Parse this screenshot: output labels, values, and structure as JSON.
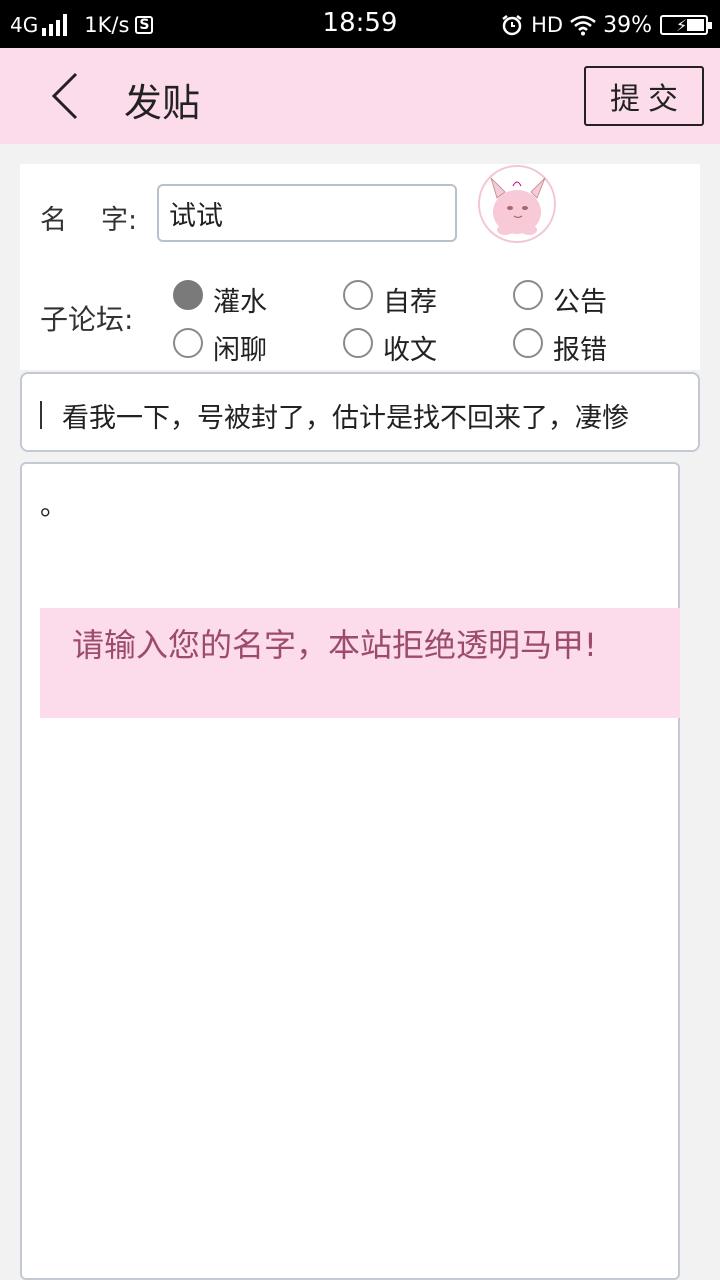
{
  "status_bar": {
    "network": "4G",
    "speed": "1K/s",
    "time": "18:59",
    "hd": "HD",
    "battery_percent": "39%",
    "battery_level": 0.39,
    "icons": [
      "signal-icon",
      "sim-icon",
      "alarm-icon",
      "wifi-icon",
      "battery-icon"
    ]
  },
  "header": {
    "title": "发贴",
    "submit_label": "提交",
    "back_icon": "chevron-left-icon",
    "background": "#fcdbea"
  },
  "form": {
    "name_label_a": "名",
    "name_label_b": "字:",
    "name_value": "试试",
    "avatar_icon": "clefairy-avatar",
    "forum_label": "子论坛:",
    "forums": [
      {
        "label": "灌水",
        "selected": true
      },
      {
        "label": "自荐",
        "selected": false
      },
      {
        "label": "公告",
        "selected": false
      },
      {
        "label": "闲聊",
        "selected": false
      },
      {
        "label": "收文",
        "selected": false
      },
      {
        "label": "报错",
        "selected": false
      }
    ],
    "title_value": "看我一下，号被封了，估计是找不回来了，凄惨",
    "content_value": "。"
  },
  "toast": {
    "message": "请输入您的名字，本站拒绝透明马甲!"
  },
  "colors": {
    "accent_pink": "#fcdbea",
    "toast_text": "#9c4a6e",
    "border": "#c4cad4"
  }
}
